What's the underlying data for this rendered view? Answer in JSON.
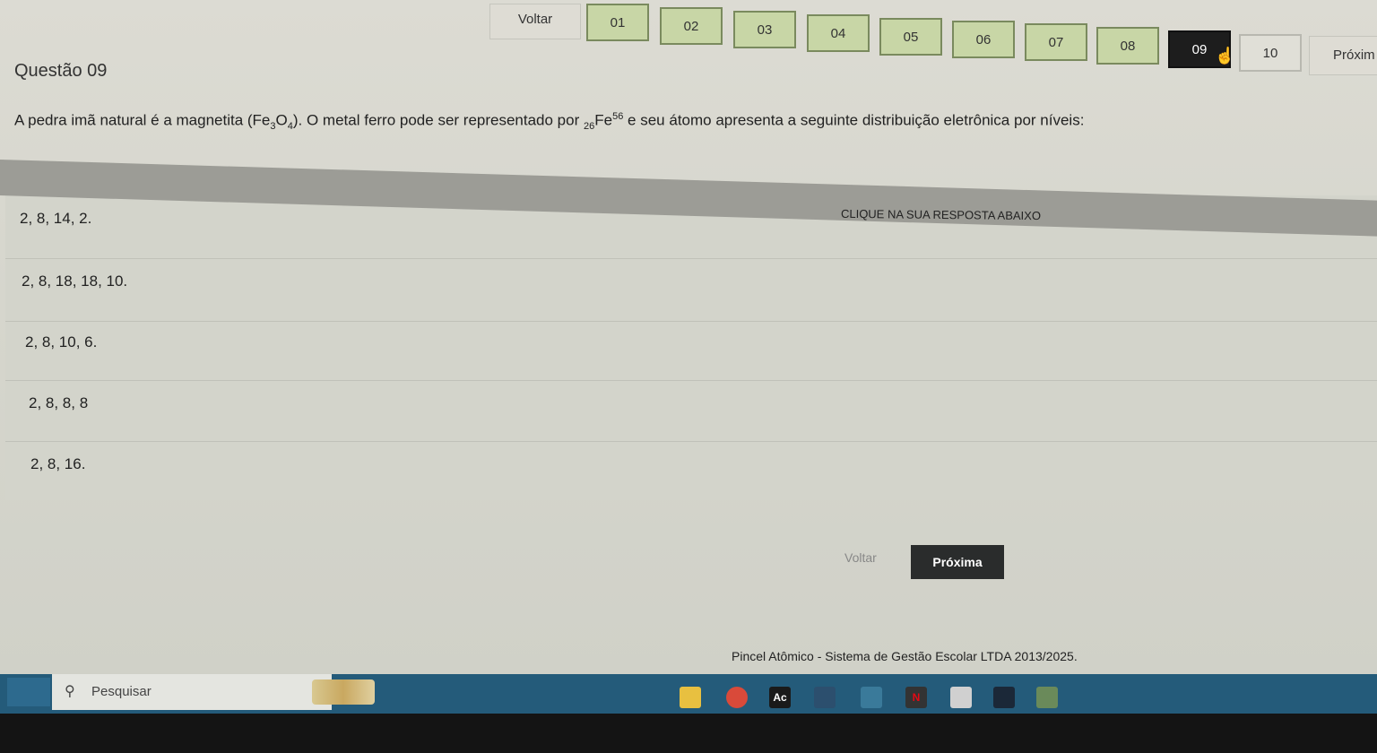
{
  "nav": {
    "back_label": "Voltar",
    "next_label": "Próxim",
    "questions": [
      "01",
      "02",
      "03",
      "04",
      "05",
      "06",
      "07",
      "08",
      "09",
      "10"
    ],
    "active_question": "09"
  },
  "question": {
    "title": "Questão 09",
    "text_part1": "A pedra imã natural é a magnetita (Fe",
    "sub1": "3",
    "text_part2": "O",
    "sub2": "4",
    "text_part3": "). O metal ferro pode ser representado por ",
    "atomic_number": "26",
    "element": "Fe",
    "mass_number": "56",
    "text_part4": " e seu átomo apresenta a seguinte distribuição eletrônica por níveis:"
  },
  "hint": "CLIQUE NA SUA RESPOSTA ABAIXO",
  "answers": [
    {
      "label": "2, 8, 14, 2."
    },
    {
      "label": "2, 8, 18, 18, 10."
    },
    {
      "label": "2, 8, 10, 6."
    },
    {
      "label": "2, 8, 8, 8"
    },
    {
      "label": "2, 8, 16."
    }
  ],
  "bottom": {
    "back_label": "Voltar",
    "next_label": "Próxima"
  },
  "footer": "Pincel Atômico - Sistema de Gestão Escolar LTDA 2013/2025.",
  "taskbar": {
    "search_placeholder": "Pesquisar",
    "apps": [
      "file-explorer-icon",
      "chrome-icon",
      "acrobat-icon",
      "vpn-icon",
      "app-icon",
      "netflix-icon",
      "app2-icon",
      "steam-icon",
      "app3-icon"
    ],
    "app_labels": [
      "",
      "",
      "Ac",
      "",
      "",
      "N",
      "",
      "",
      ""
    ]
  }
}
